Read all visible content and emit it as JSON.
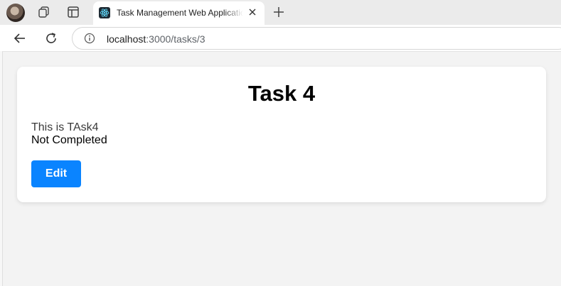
{
  "browser": {
    "tab": {
      "title": "Task Management Web Application",
      "favicon": "react-logo-icon"
    },
    "address": {
      "host": "localhost",
      "path": ":3000/tasks/3"
    },
    "icons": {
      "profile": "avatar",
      "workspaces": "workspaces-icon",
      "tab_actions": "tab-actions-icon",
      "close": "close-icon",
      "new_tab": "plus-icon",
      "back": "back-arrow-icon",
      "reload": "reload-icon",
      "site_info": "info-icon"
    }
  },
  "page": {
    "title": "Task 4",
    "description": "This is TAsk4",
    "status": "Not Completed",
    "edit_label": "Edit"
  },
  "colors": {
    "primary_button": "#0a84ff",
    "card_background": "#ffffff",
    "page_background": "#f3f3f3"
  }
}
